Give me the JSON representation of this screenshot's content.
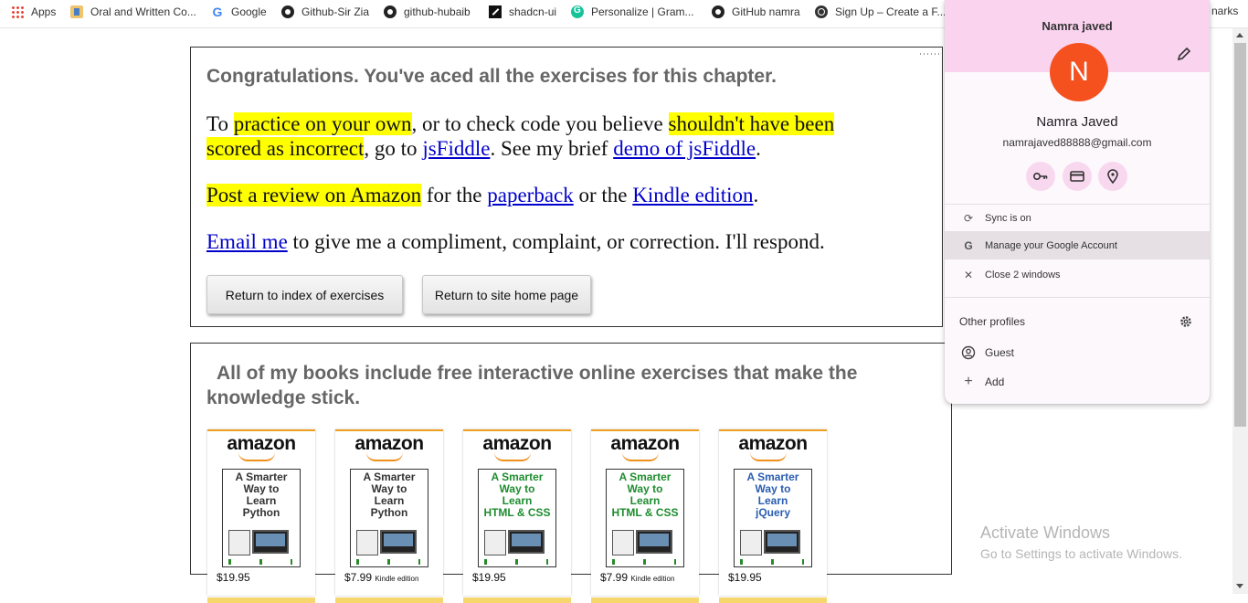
{
  "bookmarks": [
    {
      "label": "Apps",
      "icon": "apps-grid-icon"
    },
    {
      "label": "Oral and Written Co...",
      "icon": "bookmark-favicon-icon"
    },
    {
      "label": "Google",
      "icon": "google-icon"
    },
    {
      "label": "Github-Sir Zia",
      "icon": "github-icon"
    },
    {
      "label": "github-hubaib",
      "icon": "github-icon"
    },
    {
      "label": "shadcn-ui",
      "icon": "shadcn-icon"
    },
    {
      "label": "Personalize | Gram...",
      "icon": "grammarly-icon"
    },
    {
      "label": "GitHub namra",
      "icon": "github-icon"
    },
    {
      "label": "Sign Up – Create a F...",
      "icon": "globe-icon"
    }
  ],
  "bookmarks_overflow": "narks",
  "box1": {
    "heading": "Congratulations. You've aced all the exercises for this chapter.",
    "p1": {
      "t1": "To ",
      "h1": "practice on your own",
      "t2": ", or to check code you believe ",
      "h2a": "shouldn't have been",
      "h2b": "scored as incorrect",
      "t3": ", go to ",
      "link1": "jsFiddle",
      "t4": ". See my brief ",
      "link2": "demo of jsFiddle",
      "t5": "."
    },
    "p2": {
      "h1": "Post a review on Amazon",
      "t1": " for the ",
      "link1": "paperback",
      "t2": " or the ",
      "link2": "Kindle edition",
      "t3": "."
    },
    "p3": {
      "link1": "Email me",
      "t1": " to give me a compliment, complaint, or correction. I'll respond."
    },
    "btn_index": "Return to index of exercises",
    "btn_home": "Return to site home page"
  },
  "box2": {
    "heading_line1": "All of my books include free interactive online exercises that make the",
    "heading_line2": "knowledge stick.",
    "books": [
      {
        "brand": "amazon",
        "title": [
          "A Smarter",
          "Way to",
          "Learn",
          "Python"
        ],
        "title_color": "#333333",
        "price": "$19.95",
        "edition": ""
      },
      {
        "brand": "amazon",
        "title": [
          "A Smarter",
          "Way to",
          "Learn",
          "Python"
        ],
        "title_color": "#333333",
        "price": "$7.99",
        "edition": "Kindle edition"
      },
      {
        "brand": "amazon",
        "title": [
          "A Smarter",
          "Way to",
          "Learn",
          "HTML & CSS"
        ],
        "title_color": "#1e8c2e",
        "price": "$19.95",
        "edition": ""
      },
      {
        "brand": "amazon",
        "title": [
          "A Smarter",
          "Way to",
          "Learn",
          "HTML & CSS"
        ],
        "title_color": "#1e8c2e",
        "price": "$7.99",
        "edition": "Kindle edition"
      },
      {
        "brand": "amazon",
        "title": [
          "A Smarter",
          "Way to",
          "Learn",
          "jQuery"
        ],
        "title_color": "#2a5db0",
        "price": "$19.95",
        "edition": ""
      }
    ]
  },
  "profile": {
    "header_name": "Namra javed",
    "initial": "N",
    "name": "Namra Javed",
    "email": "namrajaved88888@gmail.com",
    "menu": [
      {
        "label": "Sync is on",
        "icon": "sync-icon"
      },
      {
        "label": "Manage your Google Account",
        "icon": "google-g-icon"
      },
      {
        "label": "Close 2 windows",
        "icon": "close-icon"
      }
    ],
    "other_profiles_title": "Other profiles",
    "others": [
      {
        "label": "Guest",
        "icon": "guest-icon"
      },
      {
        "label": "Add",
        "icon": "add-icon"
      }
    ],
    "accent": "#f4511e"
  },
  "watermark": {
    "line1": "Activate Windows",
    "line2": "Go to Settings to activate Windows."
  }
}
